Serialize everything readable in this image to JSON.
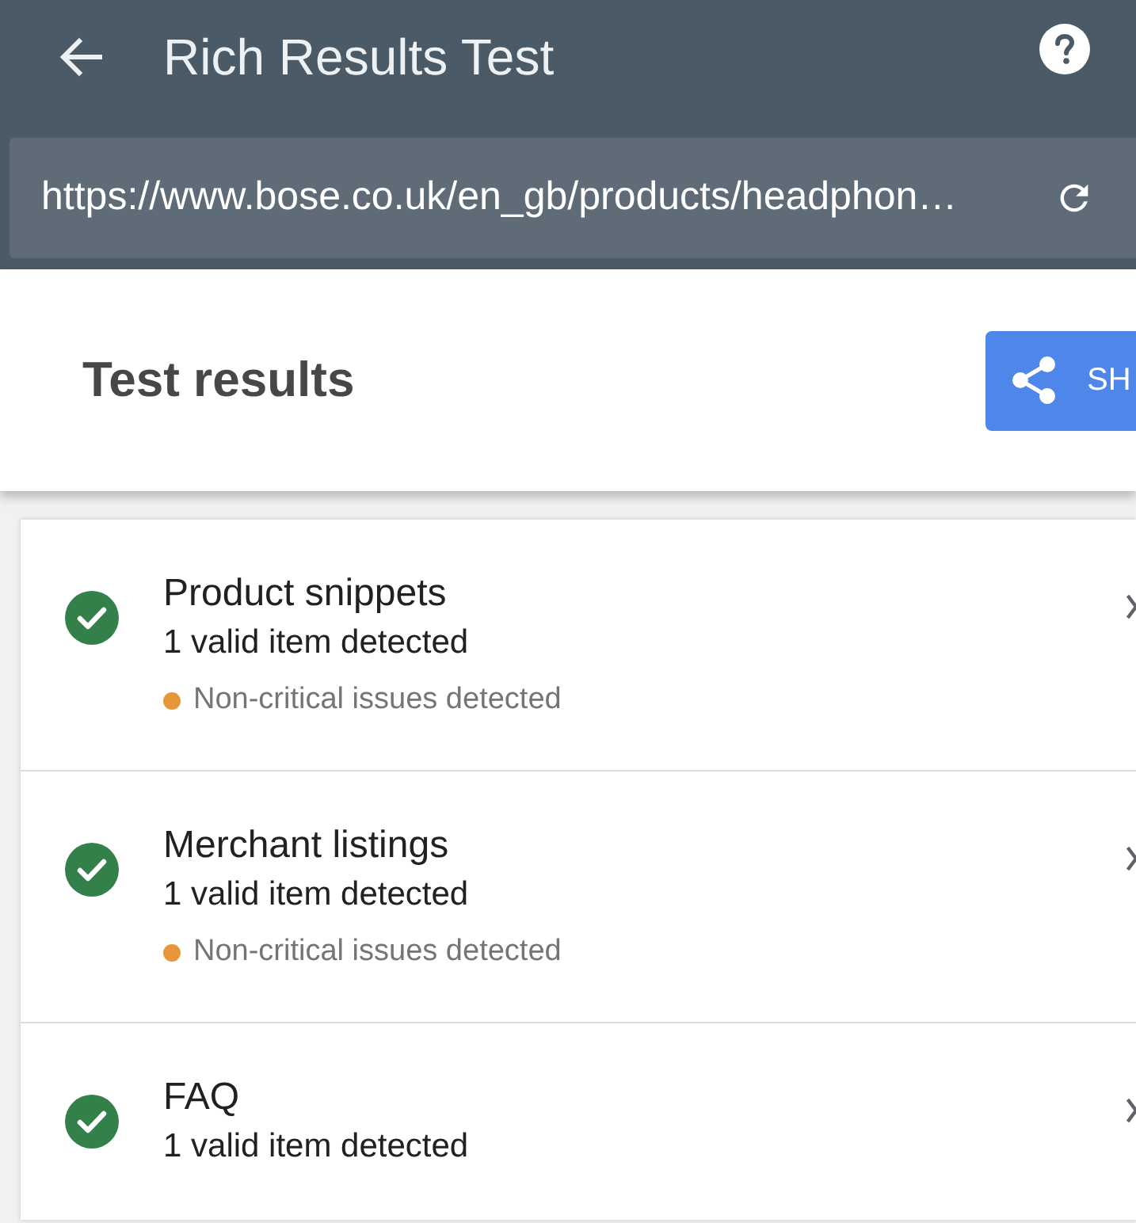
{
  "app_bar": {
    "title": "Rich Results Test"
  },
  "url_field": {
    "value": "https://www.bose.co.uk/en_gb/products/headphon…"
  },
  "results_header": {
    "title": "Test results",
    "share_button": {
      "label": "SH"
    }
  },
  "results": [
    {
      "valid": true,
      "title": "Product snippets",
      "detail": "1 valid item detected",
      "issues": "Non-critical issues detected"
    },
    {
      "valid": true,
      "title": "Merchant listings",
      "detail": "1 valid item detected",
      "issues": "Non-critical issues detected"
    },
    {
      "valid": true,
      "title": "FAQ",
      "detail": "1 valid item detected"
    }
  ]
}
